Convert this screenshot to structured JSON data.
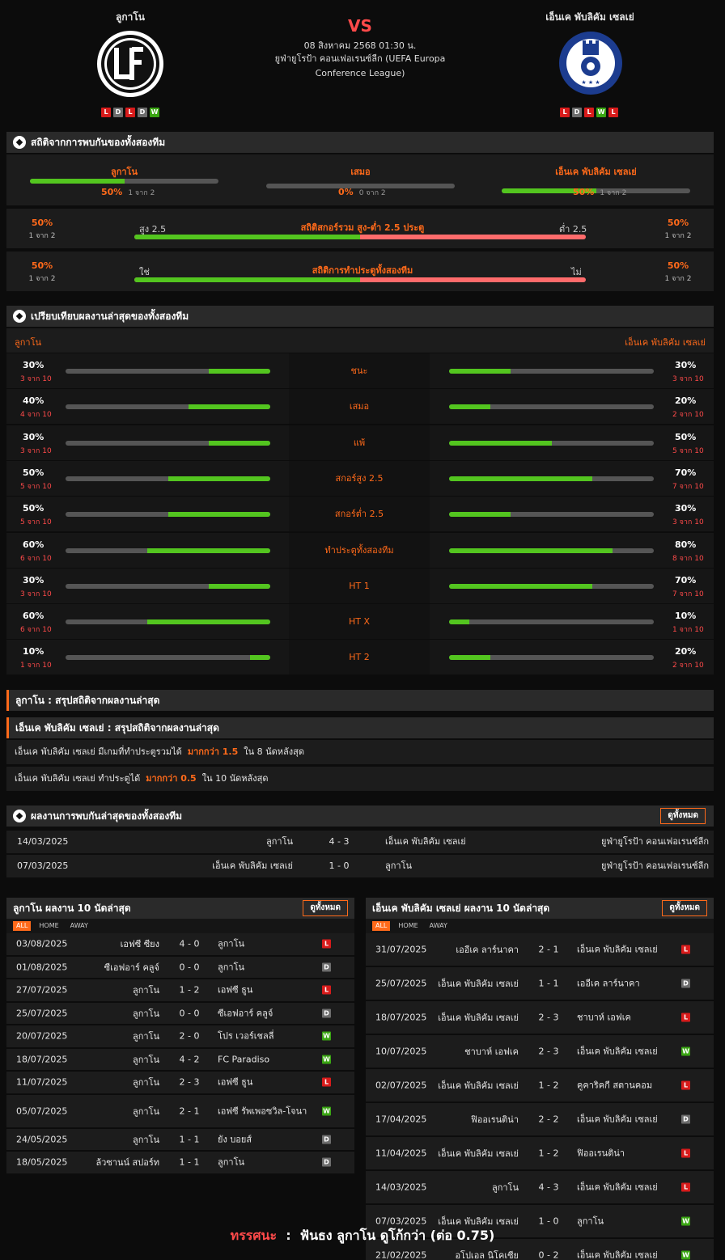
{
  "header": {
    "home": {
      "name": "ลูกาโน",
      "form": [
        "L",
        "D",
        "L",
        "D",
        "W"
      ]
    },
    "away": {
      "name": "เอ็นเค พับลิคัม เซลเย่",
      "form": [
        "L",
        "D",
        "L",
        "W",
        "L"
      ]
    },
    "vs": "VS",
    "datetime": "08 สิงหาคม 2568 01:30 น.",
    "competition": "ยูฟ่ายูโรป้า คอนเฟอเรนซ์ลีก (UEFA Europa Conference League)"
  },
  "h2h_stats": {
    "title": "สถิติจากการพบกันของทั้งสองทีม",
    "items": [
      {
        "label": "ลูกาโน",
        "pct": "50%",
        "count": "1 จาก 2",
        "fill": 0.5
      },
      {
        "label": "เสมอ",
        "pct": "0%",
        "count": "0 จาก 2",
        "fill": 0
      },
      {
        "label": "เอ็นเค พับลิคัม เซลเย่",
        "pct": "50%",
        "count": "1 จาก 2",
        "fill": 0.5
      }
    ],
    "over_under": {
      "title": "สถิติสกอร์รวม สูง-ต่ำ 2.5 ประตู",
      "left_label": "สูง 2.5",
      "right_label": "ต่ำ 2.5",
      "left_pct": "50%",
      "left_count": "1 จาก 2",
      "right_pct": "50%",
      "right_count": "1 จาก 2",
      "fill": 0.5
    },
    "btts": {
      "title": "สถิติการทำประตูทั้งสองทีม",
      "left_label": "ใช่",
      "right_label": "ไม่",
      "left_pct": "50%",
      "left_count": "1 จาก 2",
      "right_pct": "50%",
      "right_count": "1 จาก 2",
      "fill": 0.5
    }
  },
  "comparison": {
    "title": "เปรียบเทียบผลงานล่าสุดของทั้งสองทีม",
    "home": "ลูกาโน",
    "away": "เอ็นเค พับลิคัม เซลเย่",
    "rows": [
      {
        "label": "ชนะ",
        "home_pct": "30%",
        "home_count": "3 จาก 10",
        "home_fill": 0.3,
        "away_pct": "30%",
        "away_count": "3 จาก 10",
        "away_fill": 0.3
      },
      {
        "label": "เสมอ",
        "home_pct": "40%",
        "home_count": "4 จาก 10",
        "home_fill": 0.4,
        "away_pct": "20%",
        "away_count": "2 จาก 10",
        "away_fill": 0.2
      },
      {
        "label": "แพ้",
        "home_pct": "30%",
        "home_count": "3 จาก 10",
        "home_fill": 0.3,
        "away_pct": "50%",
        "away_count": "5 จาก 10",
        "away_fill": 0.5
      },
      {
        "label": "สกอร์สูง 2.5",
        "home_pct": "50%",
        "home_count": "5 จาก 10",
        "home_fill": 0.5,
        "away_pct": "70%",
        "away_count": "7 จาก 10",
        "away_fill": 0.7
      },
      {
        "label": "สกอร์ต่ำ 2.5",
        "home_pct": "50%",
        "home_count": "5 จาก 10",
        "home_fill": 0.5,
        "away_pct": "30%",
        "away_count": "3 จาก 10",
        "away_fill": 0.3
      },
      {
        "label": "ทำประตูทั้งสองทีม",
        "home_pct": "60%",
        "home_count": "6 จาก 10",
        "home_fill": 0.6,
        "away_pct": "80%",
        "away_count": "8 จาก 10",
        "away_fill": 0.8
      },
      {
        "label": "HT 1",
        "home_pct": "30%",
        "home_count": "3 จาก 10",
        "home_fill": 0.3,
        "away_pct": "70%",
        "away_count": "7 จาก 10",
        "away_fill": 0.7
      },
      {
        "label": "HT X",
        "home_pct": "60%",
        "home_count": "6 จาก 10",
        "home_fill": 0.6,
        "away_pct": "10%",
        "away_count": "1 จาก 10",
        "away_fill": 0.1
      },
      {
        "label": "HT 2",
        "home_pct": "10%",
        "home_count": "1 จาก 10",
        "home_fill": 0.1,
        "away_pct": "20%",
        "away_count": "2 จาก 10",
        "away_fill": 0.2
      }
    ]
  },
  "summary": {
    "home_title": "ลูกาโน : สรุปสถิติจากผลงานล่าสุด",
    "away_title": "เอ็นเค พับลิคัม เซลเย่ : สรุปสถิติจากผลงานล่าสุด",
    "lines": [
      {
        "pre": "เอ็นเค พับลิคัม เซลเย่  มีเกมที่ทำประตูรวมได้",
        "hl": "มากกว่า  1.5",
        "post": "ใน 8 นัดหลังสุด"
      },
      {
        "pre": "เอ็นเค พับลิคัม เซลเย่  ทำประตูได้",
        "hl": "มากกว่า  0.5",
        "post": "ใน 10 นัดหลังสุด"
      }
    ]
  },
  "h2h_results": {
    "title": "ผลงานการพบกันล่าสุดของทั้งสองทีม",
    "view_all": "ดูทั้งหมด",
    "rows": [
      {
        "date": "14/03/2025",
        "home": "ลูกาโน",
        "score": "4 - 3",
        "away": "เอ็นเค พับลิคัม เซลเย่",
        "comp": "ยูฟ่ายูโรป้า คอนเฟอเรนซ์ลีก"
      },
      {
        "date": "07/03/2025",
        "home": "เอ็นเค พับลิคัม เซลเย่",
        "score": "1 - 0",
        "away": "ลูกาโน",
        "comp": "ยูฟ่ายูโรป้า คอนเฟอเรนซ์ลีก"
      }
    ]
  },
  "home_form": {
    "title": "ลูกาโน ผลงาน 10 นัดล่าสุด",
    "view_all": "ดูทั้งหมด",
    "tabs": [
      "ALL",
      "HOME",
      "AWAY"
    ],
    "rows": [
      {
        "date": "03/08/2025",
        "home": "เอฟซี ซียง",
        "score": "4 - 0",
        "away": "ลูกาโน",
        "res": "L"
      },
      {
        "date": "01/08/2025",
        "home": "ซีเอฟอาร์ คลูจ์",
        "score": "0 - 0",
        "away": "ลูกาโน",
        "res": "D"
      },
      {
        "date": "27/07/2025",
        "home": "ลูกาโน",
        "score": "1 - 2",
        "away": "เอฟซี ธูน",
        "res": "L"
      },
      {
        "date": "25/07/2025",
        "home": "ลูกาโน",
        "score": "0 - 0",
        "away": "ซีเอฟอาร์ คลูจ์",
        "res": "D"
      },
      {
        "date": "20/07/2025",
        "home": "ลูกาโน",
        "score": "2 - 0",
        "away": "โปร เวอร์เชลลี่",
        "res": "W"
      },
      {
        "date": "18/07/2025",
        "home": "ลูกาโน",
        "score": "4 - 2",
        "away": "FC Paradiso",
        "res": "W"
      },
      {
        "date": "11/07/2025",
        "home": "ลูกาโน",
        "score": "2 - 3",
        "away": "เอฟซี ธูน",
        "res": "L"
      },
      {
        "date": "05/07/2025",
        "home": "ลูกาโน",
        "score": "2 - 1",
        "away": "เอฟซี รัพเพอซวิล-โจนา",
        "res": "W"
      },
      {
        "date": "24/05/2025",
        "home": "ลูกาโน",
        "score": "1 - 1",
        "away": "ยัง บอยส์",
        "res": "D"
      },
      {
        "date": "18/05/2025",
        "home": "ล้วซานน์ สปอร์ท",
        "score": "1 - 1",
        "away": "ลูกาโน",
        "res": "D"
      }
    ]
  },
  "away_form": {
    "title": "เอ็นเค พับลิคัม เซลเย่ ผลงาน 10 นัดล่าสุด",
    "view_all": "ดูทั้งหมด",
    "tabs": [
      "ALL",
      "HOME",
      "AWAY"
    ],
    "rows": [
      {
        "date": "31/07/2025",
        "home": "เออีเค ลาร์นาคา",
        "score": "2 - 1",
        "away": "เอ็นเค พับลิคัม เซลเย่",
        "res": "L"
      },
      {
        "date": "25/07/2025",
        "home": "เอ็นเค พับลิคัม เซลเย่",
        "score": "1 - 1",
        "away": "เออีเค ลาร์นาคา",
        "res": "D"
      },
      {
        "date": "18/07/2025",
        "home": "เอ็นเค พับลิคัม เซลเย่",
        "score": "2 - 3",
        "away": "ชาบาห์ เอฟเค",
        "res": "L"
      },
      {
        "date": "10/07/2025",
        "home": "ชาบาห์ เอฟเค",
        "score": "2 - 3",
        "away": "เอ็นเค พับลิคัม เซลเย่",
        "res": "W"
      },
      {
        "date": "02/07/2025",
        "home": "เอ็นเค พับลิคัม เซลเย่",
        "score": "1 - 2",
        "away": "คูคาริคกี สตานคอม",
        "res": "L"
      },
      {
        "date": "17/04/2025",
        "home": "ฟิออเรนติน่า",
        "score": "2 - 2",
        "away": "เอ็นเค พับลิคัม เซลเย่",
        "res": "D"
      },
      {
        "date": "11/04/2025",
        "home": "เอ็นเค พับลิคัม เซลเย่",
        "score": "1 - 2",
        "away": "ฟิออเรนติน่า",
        "res": "L"
      },
      {
        "date": "14/03/2025",
        "home": "ลูกาโน",
        "score": "4 - 3",
        "away": "เอ็นเค พับลิคัม เซลเย่",
        "res": "L"
      },
      {
        "date": "07/03/2025",
        "home": "เอ็นเค พับลิคัม เซลเย่",
        "score": "1 - 0",
        "away": "ลูกาโน",
        "res": "W"
      },
      {
        "date": "21/02/2025",
        "home": "อโปเอล นิโคเซีย",
        "score": "0 - 2",
        "away": "เอ็นเค พับลิคัม เซลเย่",
        "res": "W"
      }
    ]
  },
  "prediction": {
    "label": "ทรรศนะ",
    "sep": ":",
    "text": "ฟันธง ลูกาโน ดูโก้กว่า (ต่อ 0.75)"
  },
  "colors": {
    "accent": "#ff6a1a",
    "green": "#3aa513",
    "bar_green": "#53c51f",
    "bar_red": "#ff6b6b",
    "loss": "#d81b1b",
    "draw": "#6d6d6d"
  }
}
